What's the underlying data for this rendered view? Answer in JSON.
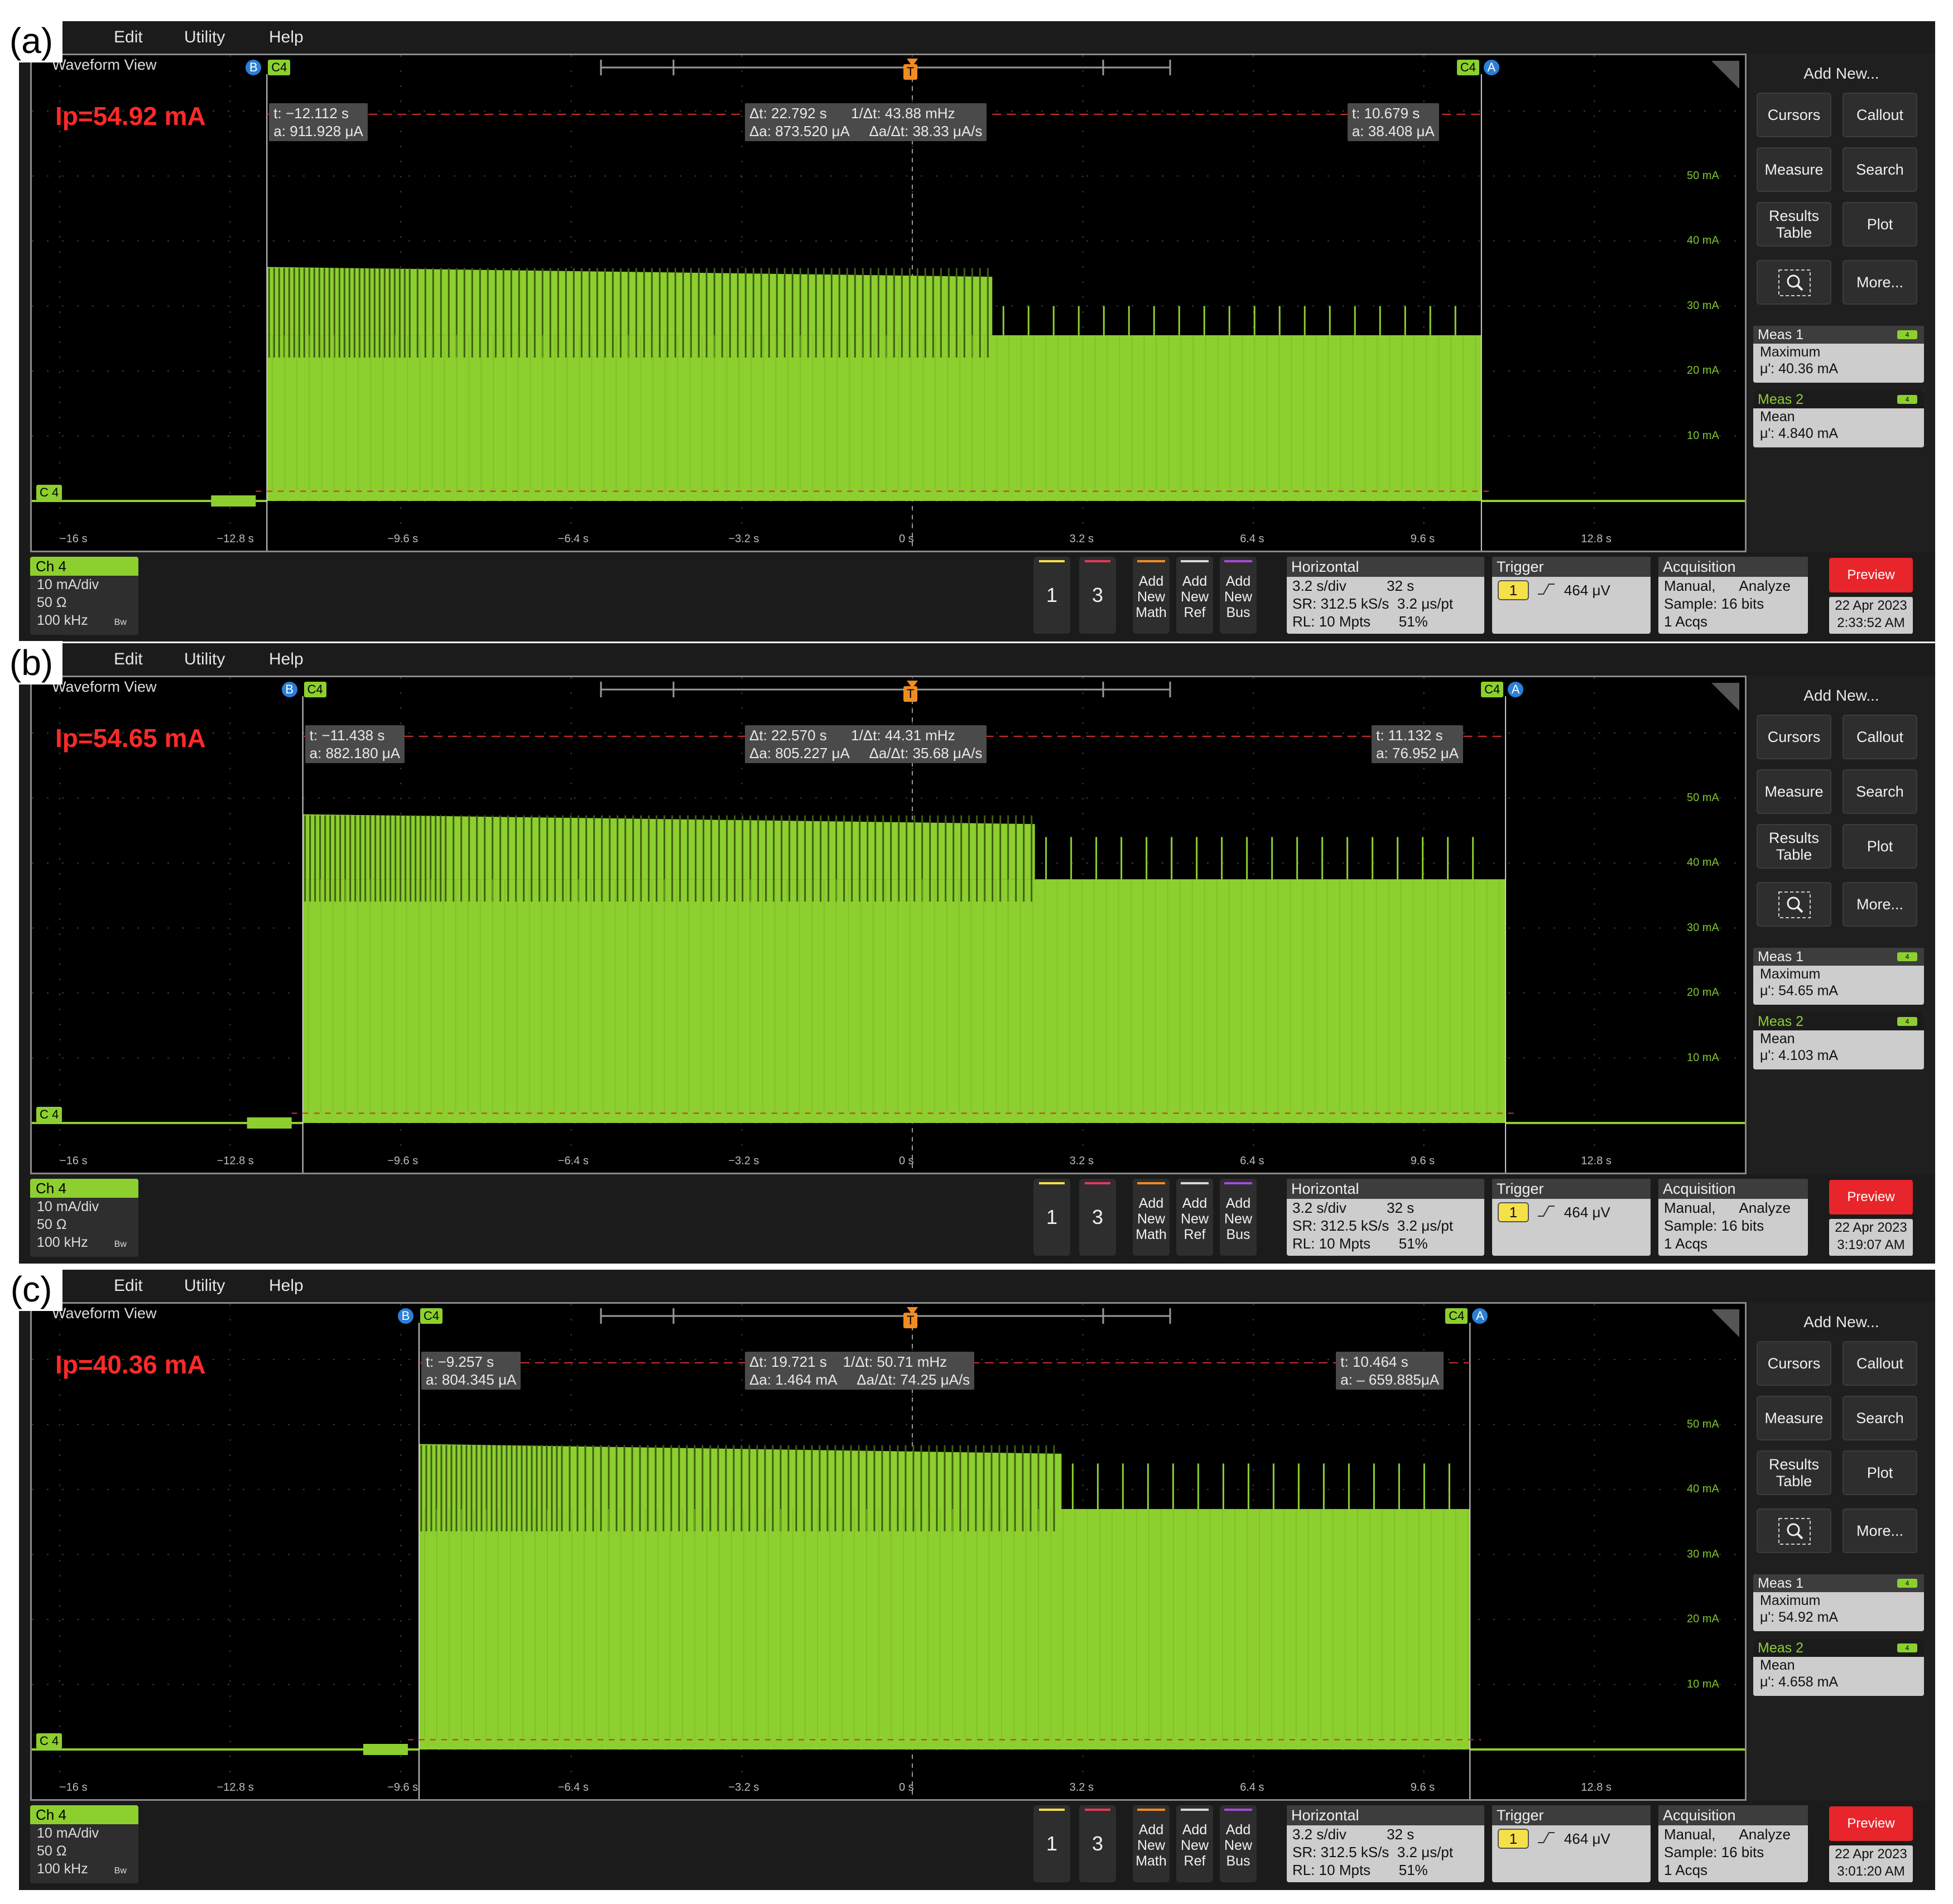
{
  "menu": [
    "Edit",
    "Utility",
    "Help"
  ],
  "waveform_title": "Waveform View",
  "x_ticks": [
    "−16 s",
    "−12.8 s",
    "−9.6 s",
    "−6.4 s",
    "−3.2 s",
    "0 s",
    "3.2 s",
    "6.4 s",
    "9.6 s",
    "12.8 s"
  ],
  "y_ticks": [
    "50 mA",
    "40 mA",
    "30 mA",
    "20 mA",
    "10 mA"
  ],
  "markers": {
    "b": "B",
    "a": "A",
    "c4": "C4",
    "trigger": "T",
    "ch_ref": "C 4"
  },
  "sidebar": {
    "add_new": "Add New...",
    "buttons": [
      "Cursors",
      "Callout",
      "Measure",
      "Search",
      "Results Table",
      "Plot",
      "",
      "More..."
    ],
    "meas1_label": "Meas 1",
    "meas1_type": "Maximum",
    "meas2_label": "Meas 2",
    "meas2_type": "Mean"
  },
  "channel": {
    "head": "Ch 4",
    "scale": "10 mA/div",
    "impedance": "50 Ω",
    "bandwidth": "100 kHz",
    "bw_tag": "Bᴡ"
  },
  "ch_buttons": [
    "1",
    "3"
  ],
  "add_buttons": [
    {
      "l1": "Add",
      "l2": "New",
      "l3": "Math"
    },
    {
      "l1": "Add",
      "l2": "New",
      "l3": "Ref"
    },
    {
      "l1": "Add",
      "l2": "New",
      "l3": "Bus"
    }
  ],
  "horizontal": {
    "title": "Horizontal",
    "line1": "3.2 s/div          32 s",
    "line2": "SR: 312.5 kS/s  3.2 μs/pt",
    "line3": "RL: 10 Mpts       51%"
  },
  "trigger": {
    "title": "Trigger",
    "channel": "1",
    "level": "464 μV"
  },
  "acquisition": {
    "title": "Acquisition",
    "line1": "Manual,      Analyze",
    "line2": "Sample: 16 bits",
    "line3": "1 Acqs"
  },
  "preview": "Preview",
  "colors": {
    "waveform": "#8dcf2f",
    "cursor_line": "#d33030",
    "label_red": "#ff2a2a",
    "panel_bg": "#1b1b1b"
  },
  "panels": [
    {
      "letter": "(a)",
      "ip": "Ip=54.92 mA",
      "cursor_b": {
        "t": "t: −12.112 s",
        "a": "a: 911.928 μA"
      },
      "delta": {
        "l1": "Δt: 22.792 s      1/Δt: 43.88 mHz",
        "l2": "Δa: 873.520 μA     Δa/Δt: 38.33 μA/s"
      },
      "cursor_a": {
        "t": "t: 10.679 s",
        "a": "a: 38.408 μA"
      },
      "meas1_value": "μ': 40.36 mA",
      "meas2_value": "μ': 4.840 mA",
      "date": "22 Apr 2023",
      "time": "2:33:52 AM",
      "x_start": -12.112,
      "x_end": 10.679,
      "envelope_mA": [
        36,
        34.5,
        30
      ],
      "level_mA": 25.5,
      "change_s": 1.5
    },
    {
      "letter": "(b)",
      "ip": "Ip=54.65 mA",
      "cursor_b": {
        "t": "t: −11.438 s",
        "a": "a: 882.180 μA"
      },
      "delta": {
        "l1": "Δt: 22.570 s      1/Δt: 44.31 mHz",
        "l2": "Δa: 805.227 μA     Δa/Δt: 35.68 μA/s"
      },
      "cursor_a": {
        "t": "t: 11.132 s",
        "a": "a: 76.952 μA"
      },
      "meas1_value": "μ': 54.65 mA",
      "meas2_value": "μ': 4.103 mA",
      "date": "22 Apr 2023",
      "time": "3:19:07 AM",
      "x_start": -11.438,
      "x_end": 11.132,
      "envelope_mA": [
        47.5,
        46,
        44
      ],
      "level_mA": 37.5,
      "change_s": 2.3
    },
    {
      "letter": "(c)",
      "ip": "Ip=40.36 mA",
      "cursor_b": {
        "t": "t: −9.257 s",
        "a": "a: 804.345 μA"
      },
      "delta": {
        "l1": "Δt: 19.721 s    1/Δt: 50.71 mHz",
        "l2": "Δa: 1.464 mA     Δa/Δt: 74.25 μA/s"
      },
      "cursor_a": {
        "t": "t: 10.464 s",
        "a": "a: – 659.885μA"
      },
      "meas1_value": "μ': 54.92 mA",
      "meas2_value": "μ': 4.658 mA",
      "date": "22 Apr 2023",
      "time": "3:01:20 AM",
      "x_start": -9.257,
      "x_end": 10.464,
      "envelope_mA": [
        47,
        45.5,
        44
      ],
      "level_mA": 37,
      "change_s": 2.8
    }
  ]
}
